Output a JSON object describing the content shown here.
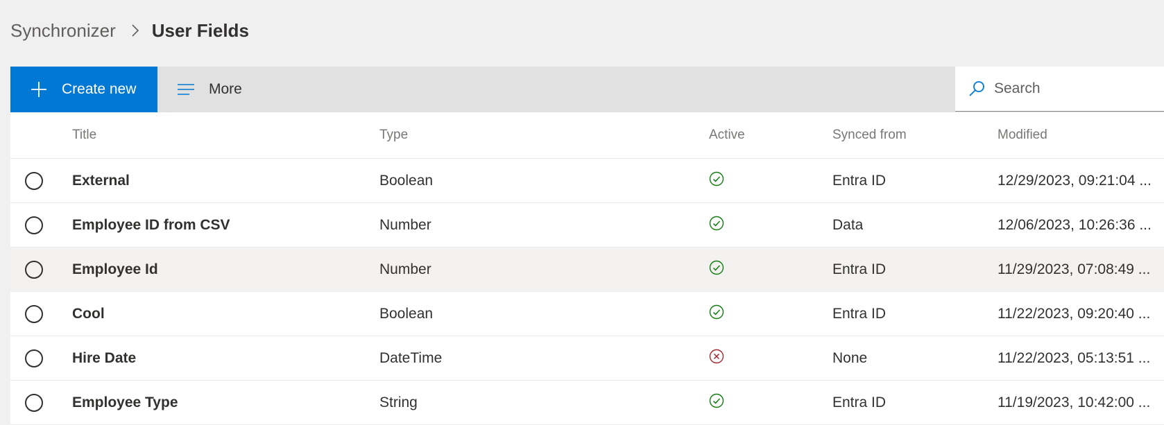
{
  "breadcrumb": {
    "root": "Synchronizer",
    "current": "User Fields"
  },
  "toolbar": {
    "create_label": "Create new",
    "more_label": "More",
    "search_placeholder": "Search"
  },
  "table": {
    "columns": [
      "Title",
      "Type",
      "Active",
      "Synced from",
      "Modified"
    ],
    "rows": [
      {
        "title": "External",
        "type": "Boolean",
        "active": true,
        "synced_from": "Entra ID",
        "modified": "12/29/2023, 09:21:04 ..."
      },
      {
        "title": "Employee ID from CSV",
        "type": "Number",
        "active": true,
        "synced_from": "Data",
        "modified": "12/06/2023, 10:26:36 ..."
      },
      {
        "title": "Employee Id",
        "type": "Number",
        "active": true,
        "synced_from": "Entra ID",
        "modified": "11/29/2023, 07:08:49 ..."
      },
      {
        "title": "Cool",
        "type": "Boolean",
        "active": true,
        "synced_from": "Entra ID",
        "modified": "11/22/2023, 09:20:40 ..."
      },
      {
        "title": "Hire Date",
        "type": "DateTime",
        "active": false,
        "synced_from": "None",
        "modified": "11/22/2023, 05:13:51 ..."
      },
      {
        "title": "Employee Type",
        "type": "String",
        "active": true,
        "synced_from": "Entra ID",
        "modified": "11/19/2023, 10:42:00 ..."
      }
    ],
    "hovered_row": 2
  },
  "icons": {
    "separator": "chevron-right-icon",
    "create": "plus-icon",
    "more": "lines-icon",
    "search": "search-icon",
    "active_true": "check-circle-icon",
    "active_false": "x-circle-icon",
    "row_select": "radio-circle-icon"
  },
  "colors": {
    "accent": "#0078d4",
    "active_true": "#107c10",
    "active_false": "#a4262c",
    "page_background": "#f0f0f0",
    "command_bar": "#e1e1e1",
    "row_hover": "#f3f2f1"
  }
}
